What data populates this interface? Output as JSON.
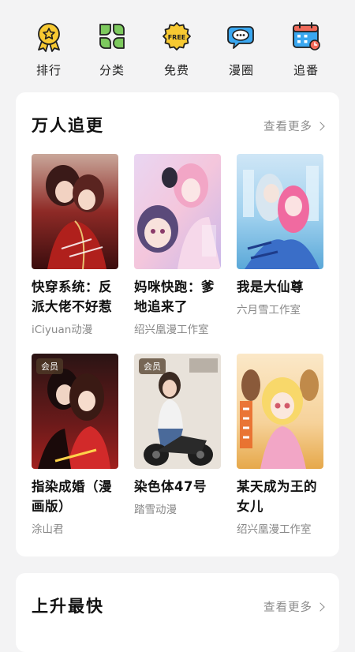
{
  "nav": {
    "items": [
      {
        "label": "排行",
        "icon": "ranking-medal-icon"
      },
      {
        "label": "分类",
        "icon": "category-leaves-icon"
      },
      {
        "label": "免费",
        "icon": "free-badge-icon"
      },
      {
        "label": "漫圈",
        "icon": "chat-bubble-icon"
      },
      {
        "label": "追番",
        "icon": "calendar-icon"
      }
    ],
    "free_badge_text": "FREE"
  },
  "sections": [
    {
      "title": "万人追更",
      "more_label": "查看更多",
      "books": [
        {
          "title": "快穿系统：反派大佬不好惹",
          "author": "iCiyuan动漫",
          "vip": ""
        },
        {
          "title": "妈咪快跑：爹地追来了",
          "author": "绍兴凰漫工作室",
          "vip": ""
        },
        {
          "title": "我是大仙尊",
          "author": "六月雪工作室",
          "vip": ""
        },
        {
          "title": "指染成婚（漫画版）",
          "author": "涂山君",
          "vip": "会员"
        },
        {
          "title": "染色体47号",
          "author": "踏雪动漫",
          "vip": "会员"
        },
        {
          "title": "某天成为王的女儿",
          "author": "绍兴凰漫工作室",
          "vip": ""
        }
      ]
    },
    {
      "title": "上升最快",
      "more_label": "查看更多"
    }
  ],
  "colors": {
    "background": "#f3f3f4",
    "card": "#ffffff",
    "icon_yellow": "#f7c932",
    "icon_green": "#7dc95e",
    "icon_blue": "#3aa7f0",
    "icon_red": "#f06a5a"
  }
}
